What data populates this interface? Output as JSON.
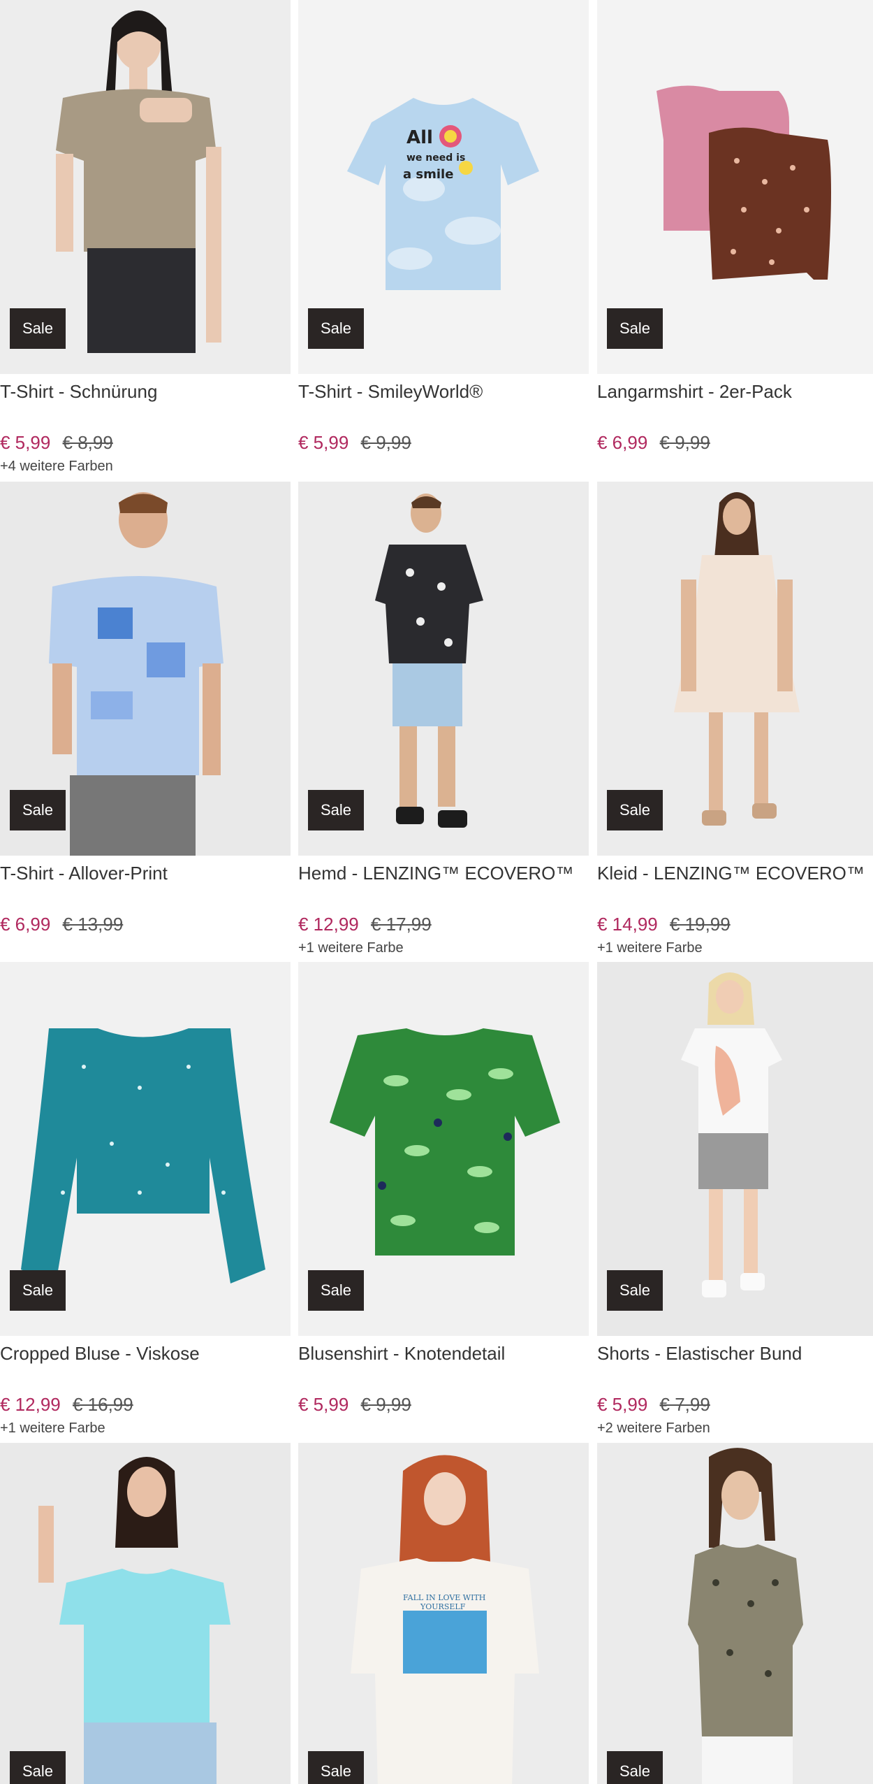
{
  "sale_label": "Sale",
  "products": [
    {
      "name": "T-Shirt - Schnürung",
      "price": "€ 5,99",
      "old_price": "€ 8,99",
      "colors": "+4 weitere Farben",
      "image": "woman-taupe-tshirt-denim-shorts"
    },
    {
      "name": "T-Shirt - SmileyWorld®",
      "price": "€ 5,99",
      "old_price": "€ 9,99",
      "colors": "",
      "image": "light-blue-cloud-smiley-tshirt"
    },
    {
      "name": "Langarmshirt - 2er-Pack",
      "price": "€ 6,99",
      "old_price": "€ 9,99",
      "colors": "",
      "image": "pink-and-brown-floral-longsleeves"
    },
    {
      "name": "T-Shirt - Allover-Print",
      "price": "€ 6,99",
      "old_price": "€ 13,99",
      "colors": "",
      "image": "man-blue-patchwork-tshirt"
    },
    {
      "name": "Hemd - LENZING™ ECOVERO™",
      "price": "€ 12,99",
      "old_price": "€ 17,99",
      "colors": "+1 weitere Farbe",
      "image": "man-black-bandana-shirt"
    },
    {
      "name": "Kleid - LENZING™ ECOVERO™",
      "price": "€ 14,99",
      "old_price": "€ 19,99",
      "colors": "+1 weitere Farbe",
      "image": "woman-cream-ruffle-dress"
    },
    {
      "name": "Cropped Bluse - Viskose",
      "price": "€ 12,99",
      "old_price": "€ 16,99",
      "colors": "+1 weitere Farbe",
      "image": "teal-floral-cropped-blouse"
    },
    {
      "name": "Blusenshirt - Knotendetail",
      "price": "€ 5,99",
      "old_price": "€ 9,99",
      "colors": "",
      "image": "green-leaf-print-blouse"
    },
    {
      "name": "Shorts - Elastischer Bund",
      "price": "€ 5,99",
      "old_price": "€ 7,99",
      "colors": "+2 weitere Farben",
      "image": "woman-grey-shorts-white-tee"
    },
    {
      "name": "",
      "price": "",
      "old_price": "",
      "colors": "",
      "image": "woman-turquoise-tshirt"
    },
    {
      "name": "",
      "price": "",
      "old_price": "",
      "colors": "",
      "image": "woman-white-print-tshirt"
    },
    {
      "name": "",
      "price": "",
      "old_price": "",
      "colors": "",
      "image": "woman-leopard-blouse"
    }
  ],
  "colors": {
    "price": "#b0285e",
    "old_price": "#555555",
    "sale_badge": "#2a2524",
    "image_bg": "#eeeeee"
  }
}
